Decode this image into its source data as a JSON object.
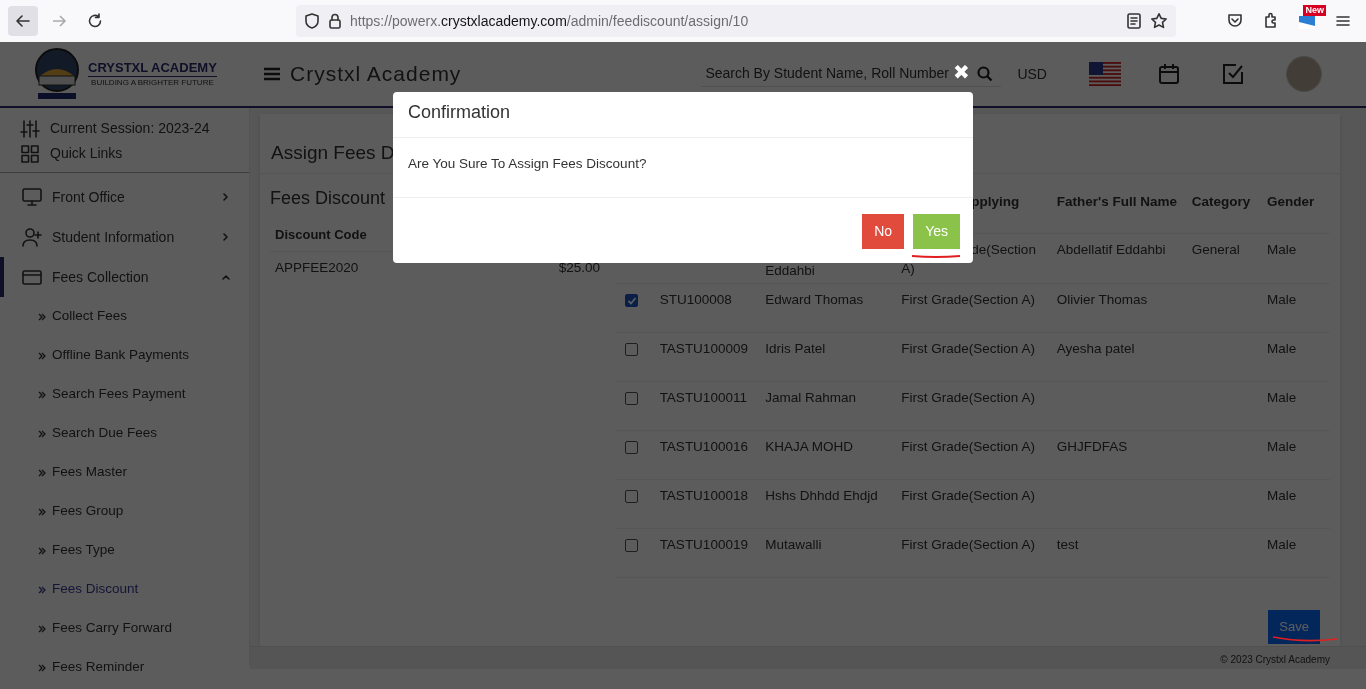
{
  "browser": {
    "url_scheme_host": "https://powerx.",
    "url_domain": "crystxlacademy.com",
    "url_path": "/admin/feediscount/assign/10",
    "extension_badge": "New"
  },
  "header": {
    "logo_title": "CRYSTXL ACADEMY",
    "logo_tagline": "BUILDING A BRIGHTER FUTURE",
    "app_title": "Crystxl Academy",
    "search_placeholder": "Search By Student Name, Roll Number",
    "currency": "USD"
  },
  "sidebar": {
    "session": "Current Session: 2023-24",
    "quick_links": "Quick Links",
    "items": [
      {
        "label": "Front Office",
        "expanded": false,
        "selected": false
      },
      {
        "label": "Student Information",
        "expanded": false,
        "selected": false
      },
      {
        "label": "Fees Collection",
        "expanded": true,
        "selected": true,
        "children": [
          {
            "label": "Collect Fees",
            "selected": false
          },
          {
            "label": "Offline Bank Payments",
            "selected": false
          },
          {
            "label": "Search Fees Payment",
            "selected": false
          },
          {
            "label": "Search Due Fees",
            "selected": false
          },
          {
            "label": "Fees Master",
            "selected": false
          },
          {
            "label": "Fees Group",
            "selected": false
          },
          {
            "label": "Fees Type",
            "selected": false
          },
          {
            "label": "Fees Discount",
            "selected": true
          },
          {
            "label": "Fees Carry Forward",
            "selected": false
          },
          {
            "label": "Fees Reminder",
            "selected": false
          }
        ]
      }
    ]
  },
  "page_title": "Assign Fees D",
  "discount_panel": {
    "title": "Fees Discount",
    "column_header": "Discount Code",
    "code": "APPFEE2020",
    "amount": "$25.00"
  },
  "student_table": {
    "headers": {
      "column_4": "pplying",
      "column_5": "Father's Full Name",
      "column_6": "Category",
      "column_7": "Gender"
    },
    "rows": [
      {
        "name": "Eddahbi",
        "class": "de(Section A)",
        "father": "Abdellatif Eddahbi",
        "category": "General",
        "gender": "Male"
      },
      {
        "checked": true,
        "admission_no": "STU100008",
        "name": "Edward Thomas",
        "class": "First Grade(Section A)",
        "father": "Olivier Thomas",
        "gender": "Male"
      },
      {
        "checked": false,
        "admission_no": "TASTU100009",
        "name": "Idris Patel",
        "class": "First Grade(Section A)",
        "father": "Ayesha patel",
        "gender": "Male"
      },
      {
        "checked": false,
        "admission_no": "TASTU100011",
        "name": "Jamal Rahman",
        "class": "First Grade(Section A)",
        "gender": "Male"
      },
      {
        "checked": false,
        "admission_no": "TASTU100016",
        "name": "KHAJA MOHD",
        "class": "First Grade(Section A)",
        "father": "GHJFDFAS",
        "gender": "Male"
      },
      {
        "checked": false,
        "admission_no": "TASTU100018",
        "name": "Hshs Dhhdd Ehdjd",
        "class": "First Grade(Section A)",
        "gender": "Male"
      },
      {
        "checked": false,
        "admission_no": "TASTU100019",
        "name": "Mutawalli",
        "class": "First Grade(Section A)",
        "father": "test",
        "gender": "Male"
      }
    ]
  },
  "save_button": "Save",
  "footer": "© 2023 Crystxl Academy",
  "modal": {
    "close": "✖",
    "title": "Confirmation",
    "message": "Are You Sure To Assign Fees Discount?",
    "buttons": [
      {
        "label": "No",
        "kind": "danger"
      },
      {
        "label": "Yes",
        "kind": "success"
      }
    ]
  }
}
